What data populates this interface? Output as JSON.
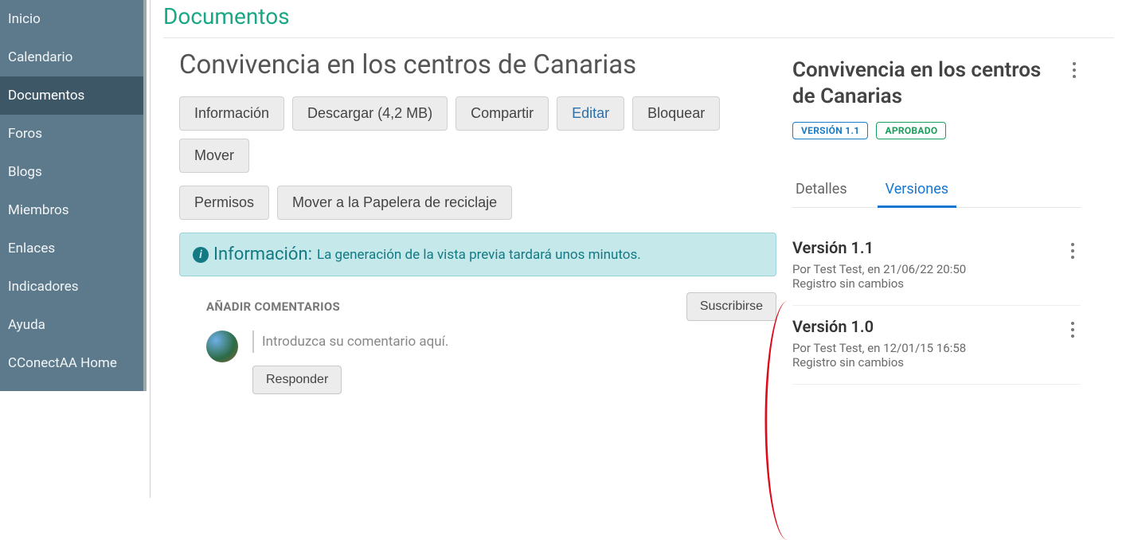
{
  "sidebar": {
    "items": [
      {
        "label": "Inicio"
      },
      {
        "label": "Calendario"
      },
      {
        "label": "Documentos",
        "active": true
      },
      {
        "label": "Foros"
      },
      {
        "label": "Blogs"
      },
      {
        "label": "Miembros"
      },
      {
        "label": "Enlaces"
      },
      {
        "label": "Indicadores"
      },
      {
        "label": "Ayuda"
      },
      {
        "label": "CConectAA Home"
      }
    ]
  },
  "page": {
    "title": "Documentos"
  },
  "document": {
    "title": "Convivencia en los centros de Canarias",
    "actions": {
      "info": "Información",
      "download": "Descargar (4,2 MB)",
      "share": "Compartir",
      "edit": "Editar",
      "lock": "Bloquear",
      "move": "Mover",
      "permissions": "Permisos",
      "recycle": "Mover a la Papelera de reciclaje"
    },
    "alert": {
      "head": "Información:",
      "body": "La generación de la vista previa tardará unos minutos."
    },
    "comments": {
      "heading": "AÑADIR COMENTARIOS",
      "subscribe": "Suscribirse",
      "placeholder": "Introduzca su comentario aquí.",
      "reply": "Responder"
    }
  },
  "side": {
    "title": "Convivencia en los centros de Canarias",
    "badges": {
      "version": "VERSIÓN 1.1",
      "status": "APROBADO"
    },
    "tabs": {
      "details": "Detalles",
      "versions": "Versiones"
    },
    "versions": [
      {
        "title": "Versión 1.1",
        "meta": "Por Test Test, en 21/06/22 20:50",
        "log": "Registro sin cambios"
      },
      {
        "title": "Versión 1.0",
        "meta": "Por Test Test, en 12/01/15 16:58",
        "log": "Registro sin cambios"
      }
    ]
  }
}
